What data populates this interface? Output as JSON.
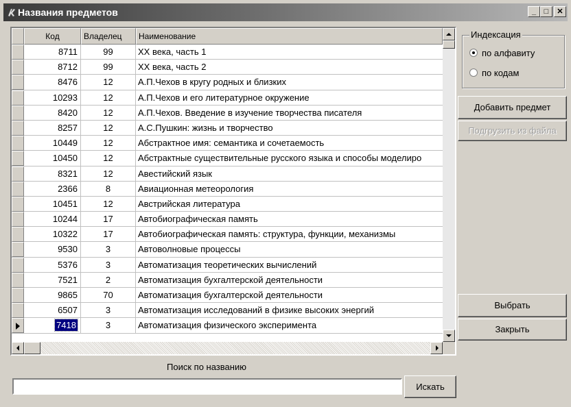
{
  "window": {
    "title": "Названия предметов",
    "controls": {
      "minimize": "_",
      "maximize": "□",
      "close": "✕"
    }
  },
  "grid": {
    "columns": [
      "Код",
      "Владелец",
      "Наименование"
    ],
    "rows": [
      {
        "code": "8711",
        "owner": "99",
        "name": "XX века,  часть 1"
      },
      {
        "code": "8712",
        "owner": "99",
        "name": "XX века,  часть 2"
      },
      {
        "code": "8476",
        "owner": "12",
        "name": "А.П.Чехов в кругу родных и близких"
      },
      {
        "code": "10293",
        "owner": "12",
        "name": "А.П.Чехов и его литературное окружение"
      },
      {
        "code": "8420",
        "owner": "12",
        "name": "А.П.Чехов. Введение в изучение творчества писателя"
      },
      {
        "code": "8257",
        "owner": "12",
        "name": "А.С.Пушкин: жизнь и творчество"
      },
      {
        "code": "10449",
        "owner": "12",
        "name": "Абстрактное имя: семантика и сочетаемость"
      },
      {
        "code": "10450",
        "owner": "12",
        "name": "Абстрактные существительные русского языка и способы моделиро"
      },
      {
        "code": "8321",
        "owner": "12",
        "name": "Авестийский язык"
      },
      {
        "code": "2366",
        "owner": "8",
        "name": "Авиационная метеорология"
      },
      {
        "code": "10451",
        "owner": "12",
        "name": "Австрийская литература"
      },
      {
        "code": "10244",
        "owner": "17",
        "name": "Автобиографическая память"
      },
      {
        "code": "10322",
        "owner": "17",
        "name": "Автобиографическая память: структура, функции, механизмы"
      },
      {
        "code": "9530",
        "owner": "3",
        "name": "Автоволновые процессы"
      },
      {
        "code": "5376",
        "owner": "3",
        "name": "Автоматизация  теоретических вычислений"
      },
      {
        "code": "7521",
        "owner": "2",
        "name": "Автоматизация бухгалтерской деятельности"
      },
      {
        "code": "9865",
        "owner": "70",
        "name": "Автоматизация бухгалтерской деятельности"
      },
      {
        "code": "6507",
        "owner": "3",
        "name": "Автоматизация исследований в физике высоких энергий"
      },
      {
        "code": "7418",
        "owner": "3",
        "name": "Автоматизация физического эксперимента"
      }
    ],
    "selected_row": 18
  },
  "indexing": {
    "legend": "Индексация",
    "options": [
      "по алфавиту",
      "по кодам"
    ],
    "selected": "по алфавиту"
  },
  "buttons": {
    "add": "Добавить предмет",
    "load": "Подгрузить из файла",
    "select": "Выбрать",
    "close": "Закрыть",
    "search": "Искать"
  },
  "search": {
    "label": "Поиск по названию",
    "value": ""
  },
  "colors": {
    "titlebar_start": "#3a3a3a",
    "selection": "#000080",
    "face": "#d4d0c8"
  }
}
